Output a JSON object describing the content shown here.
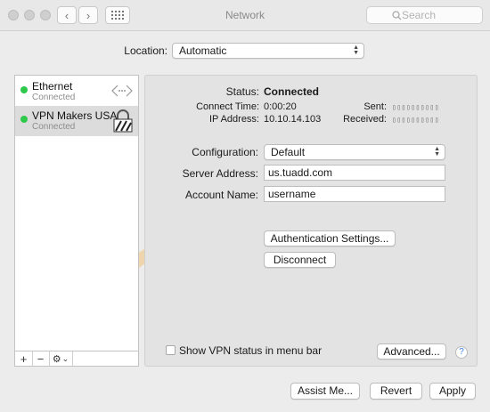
{
  "window": {
    "title": "Network",
    "search_placeholder": "Search"
  },
  "location": {
    "label": "Location:",
    "value": "Automatic"
  },
  "services": [
    {
      "name": "Ethernet",
      "status": "Connected",
      "icon": "ethernet-arrows-icon",
      "dot_color": "#2ec84a"
    },
    {
      "name": "VPN Makers USA",
      "status": "Connected",
      "icon": "vpn-lock-icon",
      "dot_color": "#2ec84a",
      "selected": true
    }
  ],
  "sidebar_tools": {
    "add": "+",
    "remove": "−",
    "gear": "⚙",
    "chevron": "⌄"
  },
  "status": {
    "label": "Status:",
    "value": "Connected",
    "connect_time_label": "Connect Time:",
    "connect_time": "0:00:20",
    "ip_label": "IP Address:",
    "ip": "10.10.14.103",
    "sent_label": "Sent:",
    "sent": "▯▯▯▯▯▯▯▯▯▯",
    "received_label": "Received:",
    "received": "▯▯▯▯▯▯▯▯▯▯"
  },
  "config": {
    "configuration_label": "Configuration:",
    "configuration_value": "Default",
    "server_label": "Server Address:",
    "server_value": "us.tuadd.com",
    "account_label": "Account Name:",
    "account_value": "username"
  },
  "buttons": {
    "auth_settings": "Authentication Settings...",
    "disconnect": "Disconnect",
    "advanced": "Advanced...",
    "help": "?",
    "assist": "Assist Me...",
    "revert": "Revert",
    "apply": "Apply"
  },
  "show_status": {
    "label": "Show VPN status in menu bar",
    "checked": false
  },
  "watermark": {
    "text": "Makers",
    "color": "#f3c27a"
  }
}
